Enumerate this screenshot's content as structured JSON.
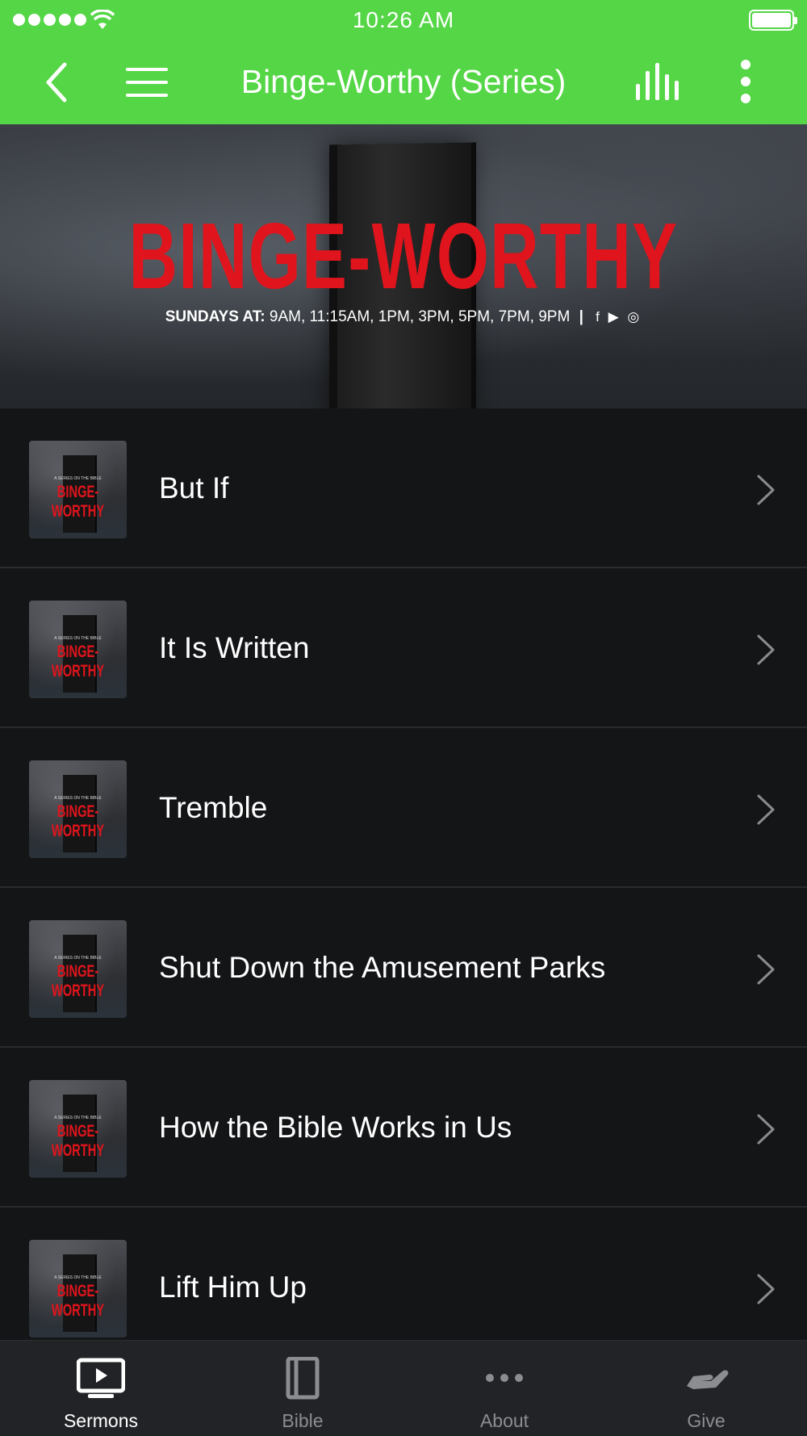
{
  "status_bar": {
    "time": "10:26 AM",
    "signal_bars": 5
  },
  "nav": {
    "title": "Binge-Worthy (Series)",
    "icons": [
      "back-chevron-icon",
      "hamburger-menu-icon",
      "audio-bars-icon",
      "more-vertical-icon"
    ]
  },
  "hero": {
    "title": "BINGE-WORTHY",
    "times_prefix": "SUNDAYS AT:",
    "times": "9AM, 11:15AM, 1PM, 3PM, 5PM, 7PM, 9PM",
    "separator": "|",
    "social": "f ▶ ◎"
  },
  "sermons": [
    {
      "title": "But If",
      "thumb_text": "BINGE-WORTHY",
      "thumb_sub": "A SERIES ON THE BIBLE"
    },
    {
      "title": "It Is Written",
      "thumb_text": "BINGE-WORTHY",
      "thumb_sub": "A SERIES ON THE BIBLE"
    },
    {
      "title": "Tremble",
      "thumb_text": "BINGE-WORTHY",
      "thumb_sub": "A SERIES ON THE BIBLE"
    },
    {
      "title": "Shut Down the Amusement Parks",
      "thumb_text": "BINGE-WORTHY",
      "thumb_sub": "A SERIES ON THE BIBLE"
    },
    {
      "title": "How the Bible Works in Us",
      "thumb_text": "BINGE-WORTHY",
      "thumb_sub": "A SERIES ON THE BIBLE"
    },
    {
      "title": "Lift Him Up",
      "thumb_text": "BINGE-WORTHY",
      "thumb_sub": "A SERIES ON THE BIBLE"
    }
  ],
  "tabs": [
    {
      "label": "Sermons",
      "icon": "tv-play-icon",
      "active": true
    },
    {
      "label": "Bible",
      "icon": "book-icon",
      "active": false
    },
    {
      "label": "About",
      "icon": "ellipsis-icon",
      "active": false
    },
    {
      "label": "Give",
      "icon": "giving-hand-icon",
      "active": false
    }
  ],
  "colors": {
    "accent_green": "#55d646",
    "background": "#141517",
    "brand_red": "#e0141c",
    "tab_inactive": "#8c8d90"
  }
}
